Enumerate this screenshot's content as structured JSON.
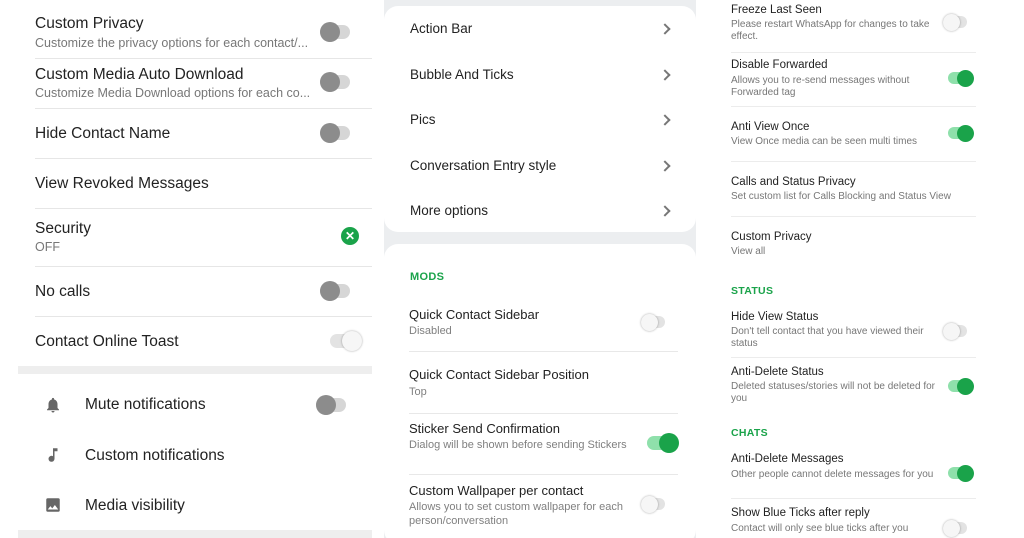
{
  "colors": {
    "accent": "#1aa34a",
    "toggle_off_knob": "#8c8c8c",
    "panel_bg": "#eceef0"
  },
  "panel1": {
    "custom_privacy": {
      "title": "Custom Privacy",
      "subtitle": "Customize the privacy options for each contact/..."
    },
    "custom_media": {
      "title": "Custom Media Auto Download",
      "subtitle": "Customize Media Download options for each co..."
    },
    "hide_contact_name": {
      "title": "Hide Contact Name"
    },
    "view_revoked": {
      "title": "View Revoked Messages"
    },
    "security": {
      "title": "Security",
      "subtitle": "OFF",
      "icon": "check-circle-icon"
    },
    "no_calls": {
      "title": "No calls"
    },
    "online_toast": {
      "title": "Contact Online Toast"
    },
    "mute": {
      "title": "Mute notifications",
      "icon": "bell-icon"
    },
    "custom_notif": {
      "title": "Custom notifications",
      "icon": "music-note-icon"
    },
    "media_vis": {
      "title": "Media visibility",
      "icon": "image-icon"
    }
  },
  "panel2": {
    "menu": [
      "Action Bar",
      "Bubble And Ticks",
      "Pics",
      "Conversation Entry style",
      "More options"
    ],
    "section": "MODS",
    "quick_sidebar": {
      "title": "Quick Contact Sidebar",
      "subtitle": "Disabled"
    },
    "sidebar_position": {
      "title": "Quick Contact Sidebar Position",
      "subtitle": "Top"
    },
    "sticker_confirm": {
      "title": "Sticker Send Confirmation",
      "subtitle": "Dialog will be shown before sending Stickers"
    },
    "wallpaper": {
      "title": "Custom Wallpaper per contact",
      "subtitle": "Allows you to set custom wallpaper for each person/conversation"
    }
  },
  "panel3": {
    "freeze": {
      "title": "Freeze Last Seen",
      "subtitle": "Please restart WhatsApp for changes to take effect."
    },
    "disable_forwarded": {
      "title": "Disable Forwarded",
      "subtitle": "Allows you to re-send messages without Forwarded tag"
    },
    "anti_view_once": {
      "title": "Anti View Once",
      "subtitle": "View Once media can be seen multi times"
    },
    "calls_status_privacy": {
      "title": "Calls and Status Privacy",
      "subtitle": "Set custom list for Calls Blocking and Status View"
    },
    "custom_privacy": {
      "title": "Custom Privacy",
      "subtitle": "View all"
    },
    "status_section": "STATUS",
    "hide_view_status": {
      "title": "Hide View Status",
      "subtitle": "Don't tell contact that you have viewed their status"
    },
    "anti_delete_status": {
      "title": "Anti-Delete Status",
      "subtitle": "Deleted statuses/stories will not be deleted for you"
    },
    "chats_section": "CHATS",
    "anti_delete_messages": {
      "title": "Anti-Delete Messages",
      "subtitle": "Other people cannot delete messages for you"
    },
    "blue_ticks": {
      "title": "Show Blue Ticks after reply",
      "subtitle": "Contact will only see blue ticks after you"
    }
  }
}
